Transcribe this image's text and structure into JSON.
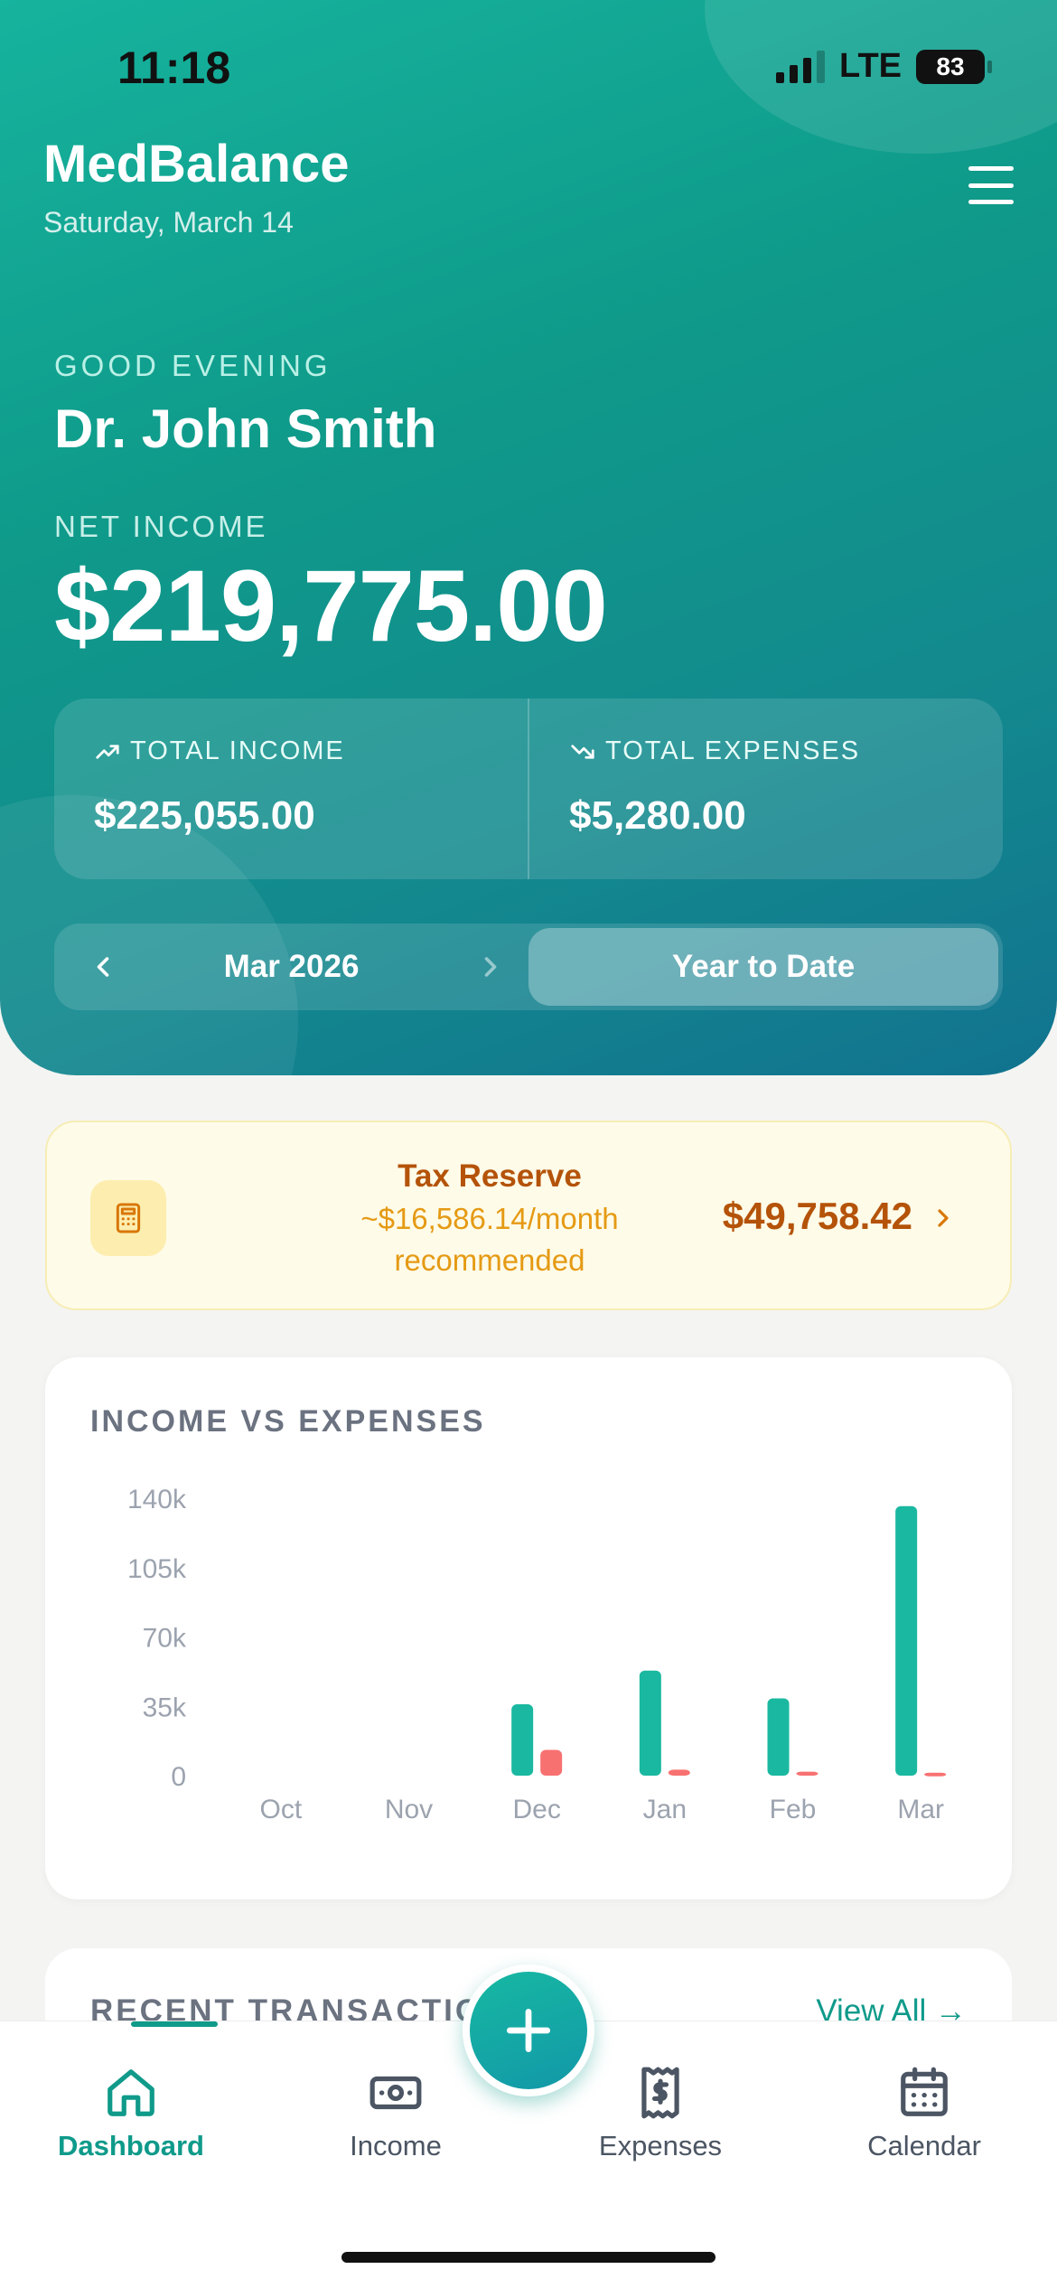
{
  "status": {
    "time": "11:18",
    "network": "LTE",
    "battery": "83"
  },
  "header": {
    "app_name": "MedBalance",
    "date": "Saturday, March 14"
  },
  "hero": {
    "greeting": "GOOD EVENING",
    "name": "Dr. John Smith",
    "net_income_label": "NET INCOME",
    "net_income_value": "$219,775.00",
    "total_income_label": "TOTAL INCOME",
    "total_income_value": "$225,055.00",
    "total_expenses_label": "TOTAL EXPENSES",
    "total_expenses_value": "$5,280.00"
  },
  "period": {
    "month_label": "Mar 2026",
    "ytd_label": "Year to Date"
  },
  "tax_reserve": {
    "title": "Tax Reserve",
    "monthly_line1": "~$16,586.14/month",
    "monthly_line2": "recommended",
    "amount": "$49,758.42"
  },
  "chart_data": {
    "type": "bar",
    "title": "INCOME VS EXPENSES",
    "categories": [
      "Oct",
      "Nov",
      "Dec",
      "Jan",
      "Feb",
      "Mar"
    ],
    "y_ticks": [
      "0",
      "35k",
      "70k",
      "105k",
      "140k"
    ],
    "ylim": [
      0,
      140000
    ],
    "series": [
      {
        "values": [
          0,
          0,
          36000,
          53000,
          39000,
          136000
        ],
        "color": "#1ab8a0"
      },
      {
        "values": [
          0,
          0,
          13000,
          3000,
          2000,
          1500
        ],
        "color": "#f87171"
      }
    ]
  },
  "recent": {
    "title": "RECENT TRANSACTIONS",
    "view_all": "View All →"
  },
  "nav": {
    "dashboard": "Dashboard",
    "income": "Income",
    "expenses": "Expenses",
    "calendar": "Calendar"
  },
  "colors": {
    "brand": "#0f9a8a",
    "expense": "#f87171",
    "tax": "#b45309"
  }
}
